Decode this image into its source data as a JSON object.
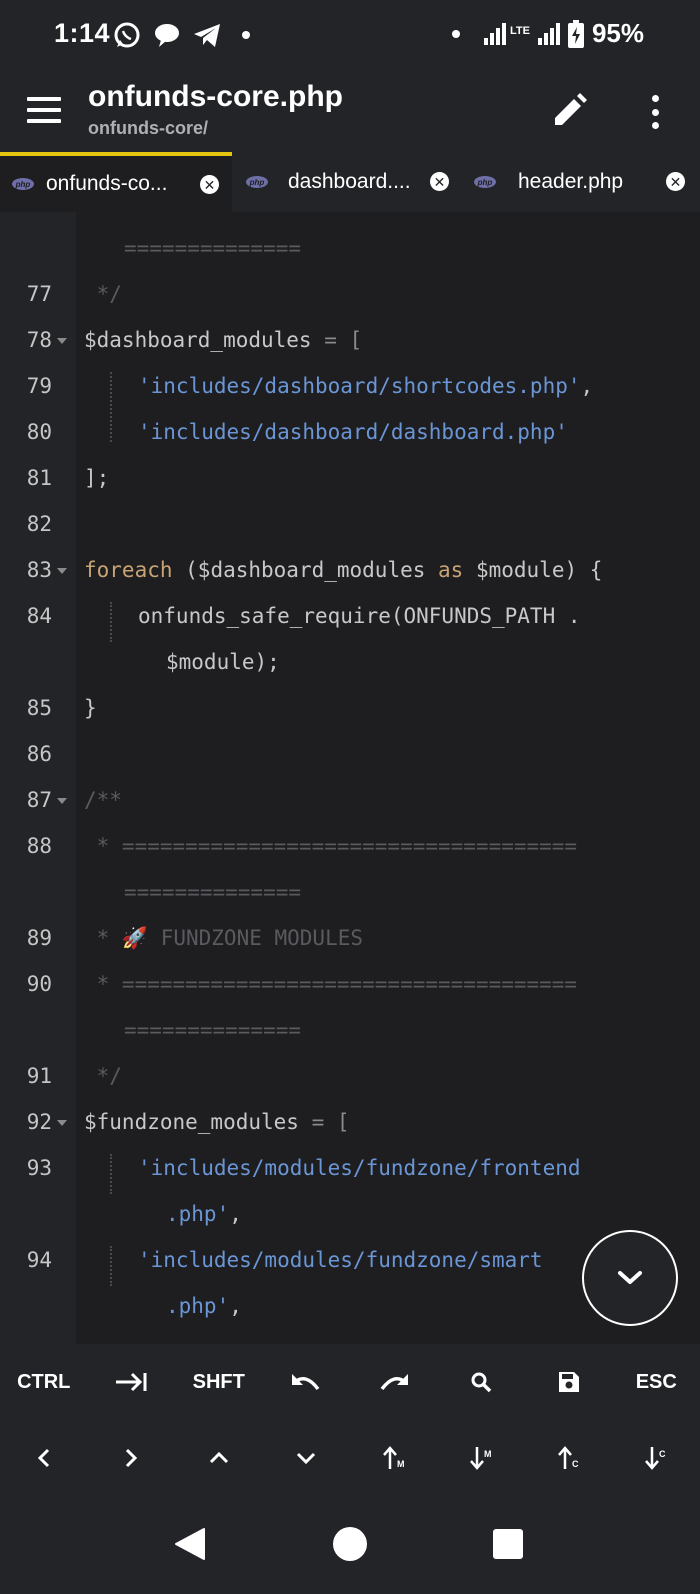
{
  "status_bar": {
    "time": "1:14",
    "network": "LTE",
    "battery": "95%",
    "left_icons": [
      "whatsapp-icon",
      "chat-icon",
      "telegram-icon"
    ],
    "right_icons": [
      "wifi-signal-icon",
      "lte-signal-icon",
      "battery-charging-icon"
    ]
  },
  "app_bar": {
    "title": "onfunds-core.php",
    "subtitle": "onfunds-core/",
    "icons": [
      "menu-icon",
      "edit-icon",
      "more-icon"
    ]
  },
  "tabs": [
    {
      "label": "onfunds-co...",
      "active": true,
      "icon": "php-file-icon"
    },
    {
      "label": "dashboard....",
      "active": false,
      "icon": "php-file-icon"
    },
    {
      "label": "header.php",
      "active": false,
      "icon": "php-file-icon"
    }
  ],
  "editor": {
    "line_numbers": [
      "77",
      "78",
      "79",
      "80",
      "81",
      "82",
      "83",
      "84",
      "85",
      "86",
      "87",
      "88",
      "89",
      "90",
      "91",
      "92",
      "93",
      "94"
    ],
    "lines": {
      "l76b": "==============",
      "l77": " */",
      "l78_var": "$dashboard_modules",
      "l78_rest": " = [",
      "l79": "'includes/dashboard/shortcodes.php'",
      "l79_comma": ",",
      "l80": "'includes/dashboard/dashboard.php'",
      "l81": "];",
      "l83_kw": "foreach",
      "l83_a": " ($dashboard_modules ",
      "l83_as": "as",
      "l83_b": " $module) {",
      "l84a": "onfunds_safe_require(ONFUNDS_PATH .",
      "l84b": "$module);",
      "l85": "}",
      "l87": "/**",
      "l88a": " * ====================================",
      "l88b": "==============",
      "l89": " * 🚀 FUNDZONE MODULES",
      "l90a": " * ====================================",
      "l90b": "==============",
      "l91": " */",
      "l92_var": "$fundzone_modules",
      "l92_rest": " = [",
      "l93a": "'includes/modules/fundzone/frontend",
      "l93b": ".php'",
      "l93_comma": ",",
      "l94a": "'includes/modules/fundzone/smart",
      "l94b": ".php'",
      "l94_comma": ","
    }
  },
  "fab": {
    "icon": "chevron-down-icon"
  },
  "key_toolbar": {
    "row1": [
      "CTRL",
      "tab-icon",
      "SHFT",
      "undo-icon",
      "redo-icon",
      "search-icon",
      "save-icon",
      "ESC"
    ],
    "row1_labels": {
      "ctrl": "CTRL",
      "shift": "SHFT",
      "esc": "ESC"
    },
    "row2": [
      "arrow-left-icon",
      "arrow-right-icon",
      "arrow-up-icon",
      "arrow-down-icon",
      "move-up-m-icon",
      "move-down-m-icon",
      "move-up-c-icon",
      "move-down-c-icon"
    ],
    "row2_labels": {
      "m": "M",
      "c": "C"
    }
  },
  "nav_bar": {
    "icons": [
      "back-icon",
      "home-icon",
      "recents-icon"
    ]
  },
  "colors": {
    "background": "#1e1e21",
    "chrome": "#232428",
    "active_tab_accent": "#e5c412",
    "string": "#6a96d6",
    "keyword": "#c8a374",
    "comment": "#5a5a5f"
  }
}
